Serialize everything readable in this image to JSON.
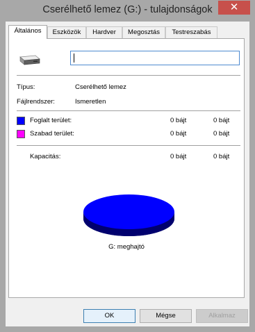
{
  "window": {
    "title": "Cserélhető lemez (G:) - tulajdonságok",
    "close_glyph": "✕"
  },
  "tabs": [
    {
      "label": "Általános",
      "active": true
    },
    {
      "label": "Eszközök",
      "active": false
    },
    {
      "label": "Hardver",
      "active": false
    },
    {
      "label": "Megosztás",
      "active": false
    },
    {
      "label": "Testreszabás",
      "active": false
    }
  ],
  "general": {
    "drive_icon": "removable-drive-icon",
    "volume_label_value": "",
    "type_label": "Típus:",
    "type_value": "Cserélhető lemez",
    "fs_label": "Fájlrendszer:",
    "fs_value": "Ismeretlen",
    "used": {
      "label": "Foglalt terület:",
      "bytes": "0 bájt",
      "size": "0 bájt",
      "color": "#0000ff"
    },
    "free": {
      "label": "Szabad terület:",
      "bytes": "0 bájt",
      "size": "0 bájt",
      "color": "#ff00ff"
    },
    "capacity": {
      "label": "Kapacitás:",
      "bytes": "0 bájt",
      "size": "0 bájt"
    },
    "drive_caption": "G: meghajtó"
  },
  "buttons": {
    "ok": "OK",
    "cancel": "Mégse",
    "apply": "Alkalmaz"
  }
}
